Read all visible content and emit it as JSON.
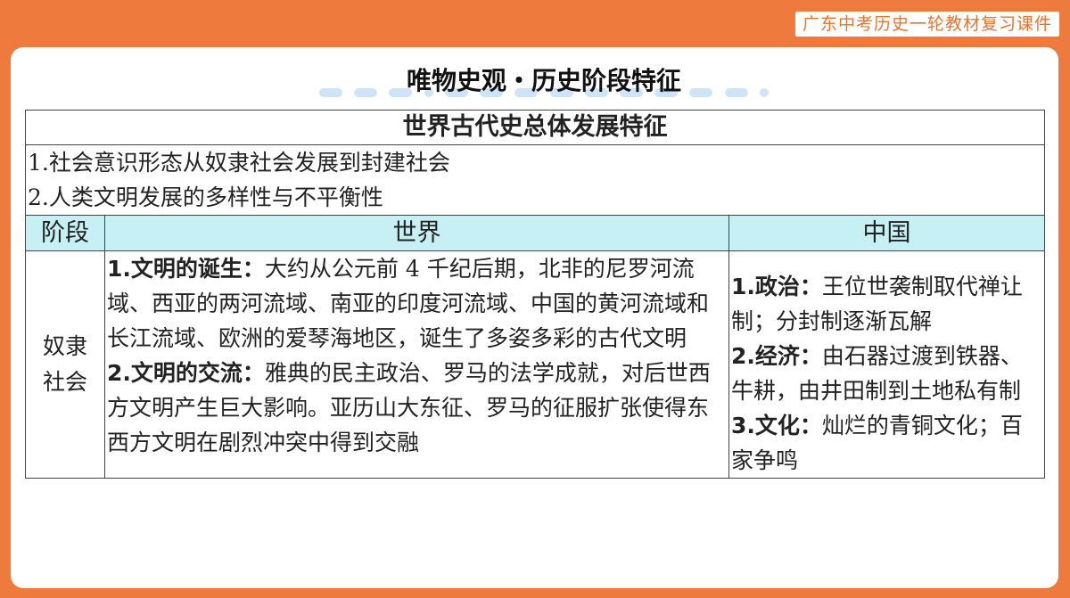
{
  "header_tag": "广东中考历史一轮教材复习课件",
  "slide_title": "唯物史观・历史阶段特征",
  "table": {
    "title": "世界古代史总体发展特征",
    "intro_lines": [
      "1.社会意识形态从奴隶社会发展到封建社会",
      "2.人类文明发展的多样性与不平衡性"
    ],
    "headers": [
      "阶段",
      "世界",
      "中国"
    ],
    "stage": [
      "奴隶",
      "社会"
    ],
    "world": [
      {
        "label": "1.文明的诞生：",
        "text": "大约从公元前 4 千纪后期，北非的尼罗河流域、西亚的两河流域、南亚的印度河流域、中国的黄河流域和长江流域、欧洲的爱琴海地区，诞生了多姿多彩的古代文明"
      },
      {
        "label": "2.文明的交流：",
        "text": "雅典的民主政治、罗马的法学成就，对后世西方文明产生巨大影响。亚历山大东征、罗马的征服扩张使得东西方文明在剧烈冲突中得到交融"
      }
    ],
    "china": [
      {
        "label": "1.政治：",
        "text": "王位世袭制取代禅让制；分封制逐渐瓦解"
      },
      {
        "label": "2.经济：",
        "text": "由石器过渡到铁器、牛耕，由井田制到土地私有制"
      },
      {
        "label": "3.文化：",
        "text": "灿烂的青铜文化；百家争鸣"
      }
    ]
  }
}
